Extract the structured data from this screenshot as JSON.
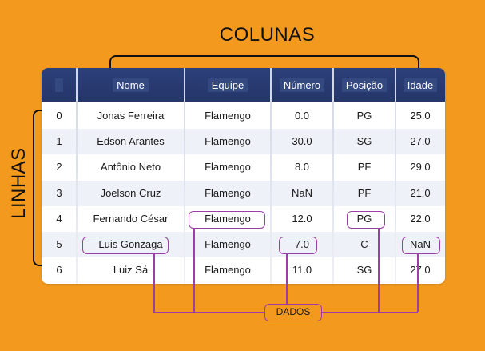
{
  "labels": {
    "columns": "COLUNAS",
    "rows": "LINHAS",
    "data": "DADOS"
  },
  "table": {
    "headers": [
      "",
      "Nome",
      "Equipe",
      "Número",
      "Posição",
      "Idade"
    ],
    "rows": [
      {
        "index": "0",
        "nome": "Jonas Ferreira",
        "equipe": "Flamengo",
        "numero": "0.0",
        "posicao": "PG",
        "idade": "25.0"
      },
      {
        "index": "1",
        "nome": "Edson Arantes",
        "equipe": "Flamengo",
        "numero": "30.0",
        "posicao": "SG",
        "idade": "27.0"
      },
      {
        "index": "2",
        "nome": "Antônio Neto",
        "equipe": "Flamengo",
        "numero": "8.0",
        "posicao": "PF",
        "idade": "29.0"
      },
      {
        "index": "3",
        "nome": "Joelson Cruz",
        "equipe": "Flamengo",
        "numero": "NaN",
        "posicao": "PF",
        "idade": "21.0"
      },
      {
        "index": "4",
        "nome": "Fernando César",
        "equipe": "Flamengo",
        "numero": "12.0",
        "posicao": "PG",
        "idade": "22.0"
      },
      {
        "index": "5",
        "nome": "Luis Gonzaga",
        "equipe": "Flamengo",
        "numero": "7.0",
        "posicao": "C",
        "idade": "NaN"
      },
      {
        "index": "6",
        "nome": "Luiz Sá",
        "equipe": "Flamengo",
        "numero": "11.0",
        "posicao": "SG",
        "idade": "27.0"
      }
    ]
  },
  "colors": {
    "background": "#F39A1E",
    "header": "#2c3f78",
    "highlight": "#9b3fa6",
    "row_alt": "#eef1f7"
  }
}
